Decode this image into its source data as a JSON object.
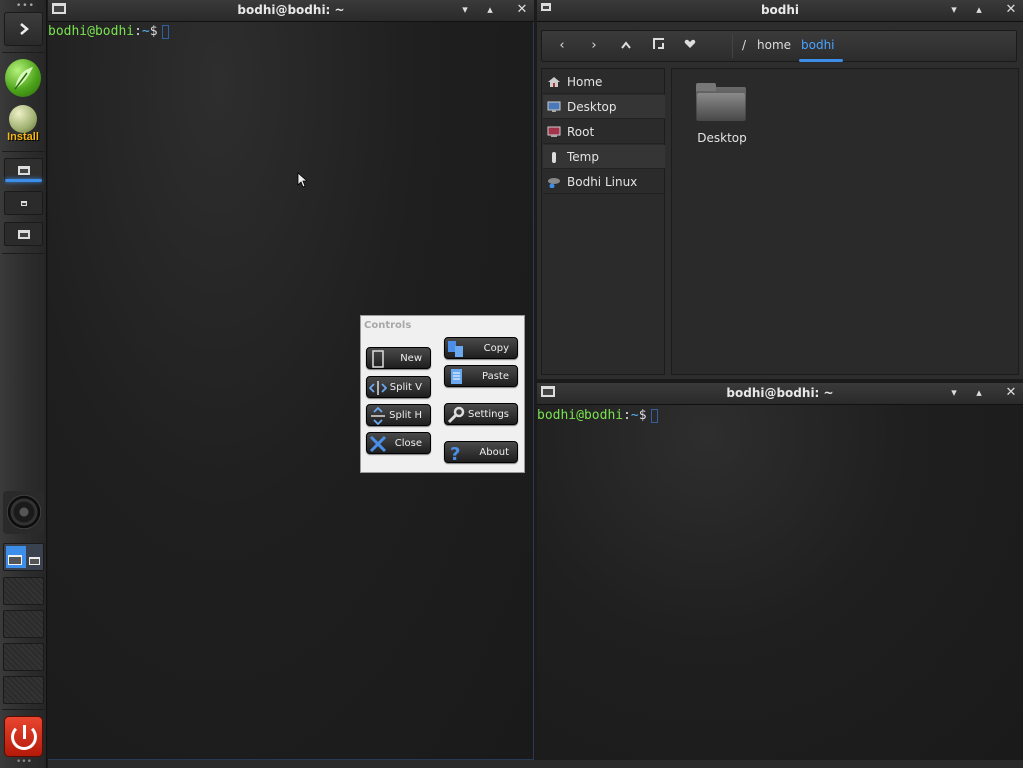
{
  "shelf": {
    "install_label": "Install"
  },
  "terminal_left": {
    "title": "bodhi@bodhi: ~",
    "prompt_user": "bodhi@bodhi",
    "prompt_sep": ":",
    "prompt_path": "~",
    "prompt_sym": "$"
  },
  "terminal_right": {
    "title": "bodhi@bodhi: ~",
    "prompt_user": "bodhi@bodhi",
    "prompt_sep": ":",
    "prompt_path": "~",
    "prompt_sym": "$"
  },
  "file_manager": {
    "title": "bodhi",
    "breadcrumb": [
      "/",
      "home",
      "bodhi"
    ],
    "sidebar": [
      {
        "label": "Home",
        "icon": "home-icon"
      },
      {
        "label": "Desktop",
        "icon": "desktop-icon"
      },
      {
        "label": "Root",
        "icon": "root-icon"
      },
      {
        "label": "Temp",
        "icon": "temp-icon"
      },
      {
        "label": "Bodhi Linux",
        "icon": "drive-icon"
      }
    ],
    "items": [
      {
        "label": "Desktop",
        "icon": "folder-icon"
      }
    ]
  },
  "controls": {
    "title": "Controls",
    "buttons": {
      "new": "New",
      "split_v": "Split V",
      "split_h": "Split H",
      "close": "Close",
      "copy": "Copy",
      "paste": "Paste",
      "settings": "Settings",
      "about": "About"
    }
  },
  "colors": {
    "accent": "#3d8ee8",
    "prompt_user": "#79e34f",
    "prompt_path": "#5ab4f2"
  }
}
